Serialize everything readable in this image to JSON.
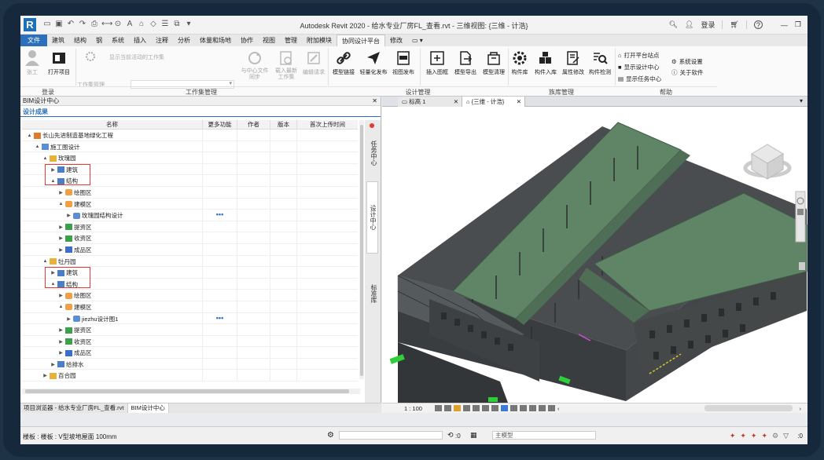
{
  "window": {
    "title": "Autodesk Revit 2020 - 给水专业厂房FL_查看.rvt - 三维视图: {三维 - 计浩}",
    "logo": "R",
    "login": "登录",
    "help": "?"
  },
  "tabs": [
    "文件",
    "建筑",
    "结构",
    "钢",
    "系统",
    "插入",
    "注释",
    "分析",
    "体量和场地",
    "协作",
    "视图",
    "管理",
    "附加模块",
    "协同设计平台",
    "修改"
  ],
  "ribbon": {
    "login_group": "登录",
    "login_btn": "张工",
    "open_project": "打开项目",
    "show_workset": "显示当前活动的工作集",
    "workset_mgmt": "工作集管理",
    "workset_group": "工作集管理",
    "sync": "与中心文件\n同步",
    "load_latest": "载入最新\n工作集",
    "edit_request": "编辑请求",
    "design_group": "设计管理",
    "model_link": "模型链接",
    "light_publish": "轻量化发布",
    "view_publish": "视图发布",
    "insert_frame": "插入图框",
    "model_export": "模型导出",
    "model_clean": "模型清理",
    "family_group": "族库管理",
    "comp_lib": "构件库",
    "comp_in": "构件入库",
    "prop_edit": "属性修改",
    "comp_check": "构件检测",
    "help_group": "帮助",
    "open_site": "打开平台站点",
    "show_design": "显示设计中心",
    "show_task": "显示任务中心",
    "sys_settings": "系统设置",
    "about": "关于软件"
  },
  "left_panel": {
    "title": "BIM设计中心",
    "subtab": "设计成果",
    "columns": [
      "名称",
      "更多功能",
      "作者",
      "版本",
      "首次上传时间"
    ],
    "rows": [
      {
        "label": "长山先进制造基地绿化工程",
        "level": 0,
        "icon": "project",
        "toggle": "▲"
      },
      {
        "label": "施工图设计",
        "level": 1,
        "icon": "stage",
        "toggle": "▲"
      },
      {
        "label": "玫瑰园",
        "level": 2,
        "icon": "folder",
        "toggle": "▲"
      },
      {
        "label": "建筑",
        "level": 3,
        "icon": "model",
        "toggle": "▶"
      },
      {
        "label": "结构",
        "level": 3,
        "icon": "model",
        "toggle": "▲"
      },
      {
        "label": "绘图区",
        "level": 4,
        "icon": "draw",
        "toggle": "▶"
      },
      {
        "label": "建模区",
        "level": 4,
        "icon": "draw",
        "toggle": "▲"
      },
      {
        "label": "玫瑰园结构设计",
        "level": 5,
        "icon": "cube",
        "toggle": "▶",
        "more": "•••"
      },
      {
        "label": "提资区",
        "level": 4,
        "icon": "chart",
        "toggle": "▶"
      },
      {
        "label": "收资区",
        "level": 4,
        "icon": "chart",
        "toggle": "▶"
      },
      {
        "label": "成品区",
        "level": 4,
        "icon": "people",
        "toggle": "▶"
      },
      {
        "label": "牡丹园",
        "level": 2,
        "icon": "folder",
        "toggle": "▲"
      },
      {
        "label": "建筑",
        "level": 3,
        "icon": "model",
        "toggle": "▶"
      },
      {
        "label": "结构",
        "level": 3,
        "icon": "model",
        "toggle": "▲"
      },
      {
        "label": "绘图区",
        "level": 4,
        "icon": "draw",
        "toggle": "▶"
      },
      {
        "label": "建模区",
        "level": 4,
        "icon": "draw",
        "toggle": "▲"
      },
      {
        "label": "jiezhu设计图1",
        "level": 5,
        "icon": "cube",
        "toggle": "▶",
        "more": "•••"
      },
      {
        "label": "提资区",
        "level": 4,
        "icon": "chart",
        "toggle": "▶"
      },
      {
        "label": "收资区",
        "level": 4,
        "icon": "chart",
        "toggle": "▶"
      },
      {
        "label": "成品区",
        "level": 4,
        "icon": "people",
        "toggle": "▶"
      },
      {
        "label": "给排水",
        "level": 3,
        "icon": "model",
        "toggle": "▶"
      },
      {
        "label": "百合园",
        "level": 2,
        "icon": "folder",
        "toggle": "▶"
      }
    ],
    "side_tabs": [
      "任务中心",
      "设计中心",
      "标准库"
    ],
    "bottom_tabs": [
      "项目浏览器 - 给水专业厂房FL_查看.rvt",
      "BIM设计中心"
    ]
  },
  "viewport": {
    "tabs": [
      "标高 1",
      "{三维 - 计浩}"
    ],
    "scale": "1 : 100"
  },
  "status": {
    "text": "楼板 : 楼板 : V型坡地屋面 100mm",
    "model": "主模型",
    "count": ":0",
    "filter": ":0"
  },
  "colors": {
    "accent": "#2d6fb8",
    "roof": "#5f8466",
    "highlight": "#e53935"
  }
}
